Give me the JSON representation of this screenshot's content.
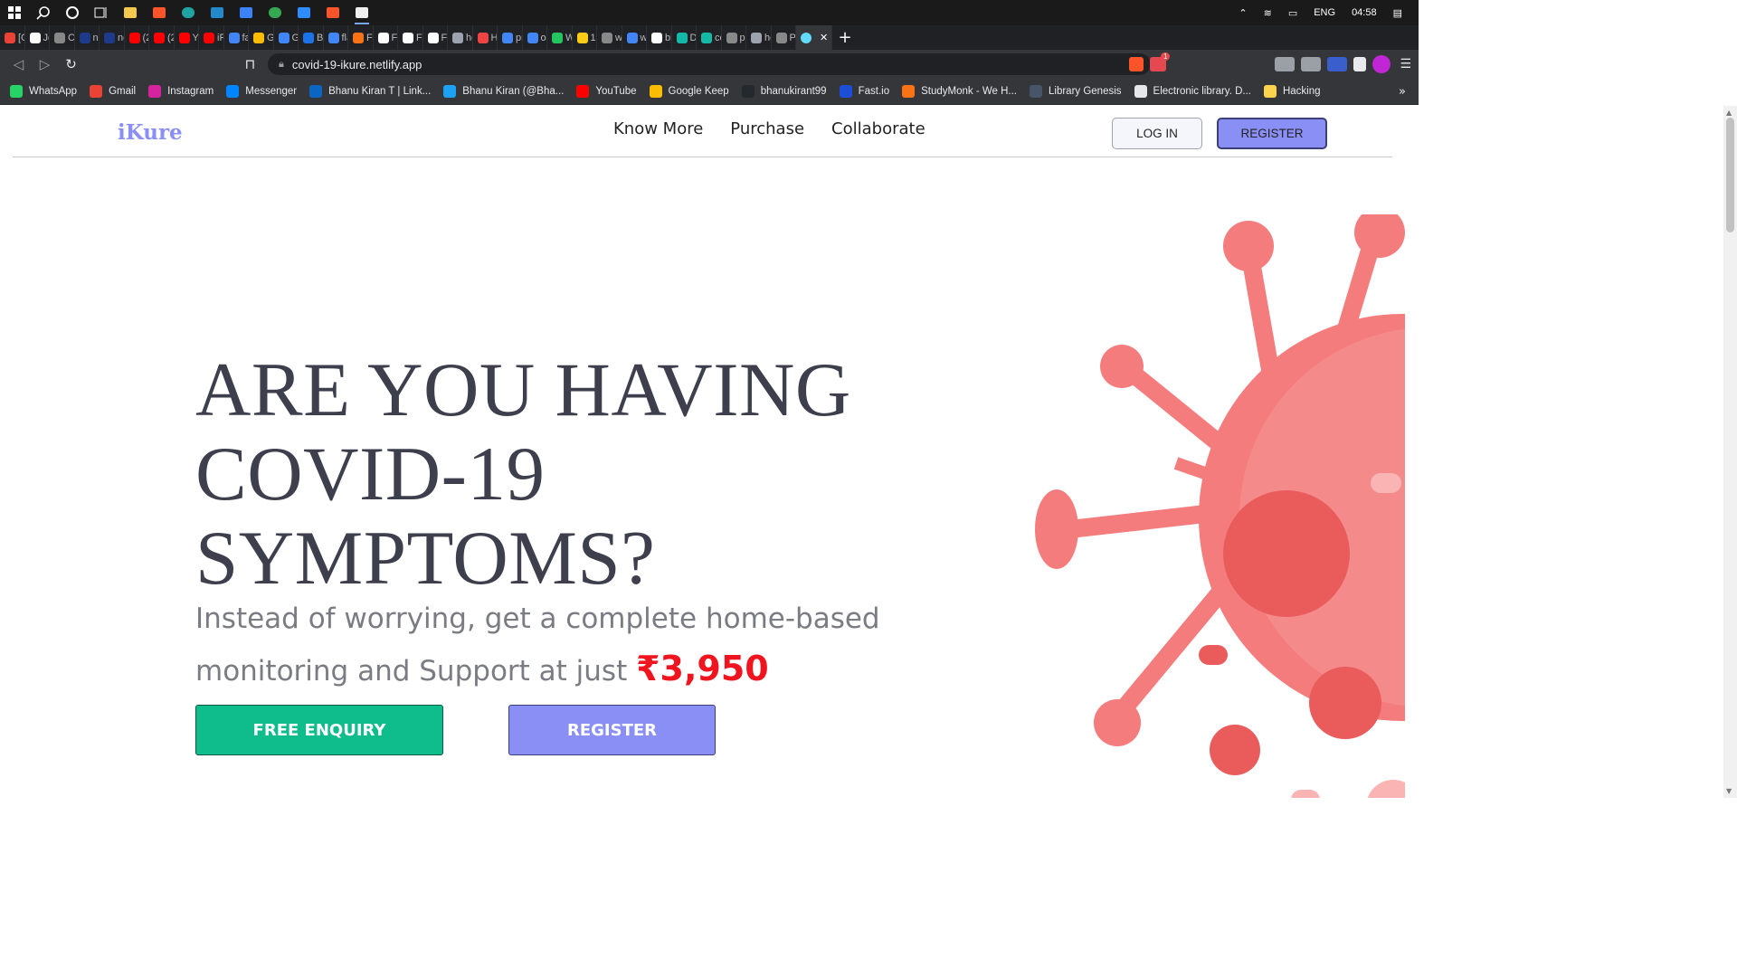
{
  "taskbar": {
    "lang": "ENG",
    "time": "04:58"
  },
  "tabs": [
    {
      "label": "[G",
      "color": "#ea4335"
    },
    {
      "label": "Jo",
      "color": "#ffffff"
    },
    {
      "label": "CS",
      "color": "#888888"
    },
    {
      "label": "ne",
      "color": "#1e3a8a"
    },
    {
      "label": "ne",
      "color": "#1e3a8a"
    },
    {
      "label": "(2",
      "color": "#ff0000"
    },
    {
      "label": "(2",
      "color": "#ff0000"
    },
    {
      "label": "Yo",
      "color": "#ff0000"
    },
    {
      "label": "iPl",
      "color": "#ff0000"
    },
    {
      "label": "fai",
      "color": "#4285f4"
    },
    {
      "label": "Gc",
      "color": "#fbbc04"
    },
    {
      "label": "Gc",
      "color": "#4285f4"
    },
    {
      "label": "BN",
      "color": "#1a73e8"
    },
    {
      "label": "fla",
      "color": "#4285f4"
    },
    {
      "label": "Fla",
      "color": "#f97316"
    },
    {
      "label": "Fla",
      "color": "#ffffff"
    },
    {
      "label": "Fla",
      "color": "#ffffff"
    },
    {
      "label": "Fla",
      "color": "#ffffff"
    },
    {
      "label": "ho",
      "color": "#9ca3af"
    },
    {
      "label": "Hi",
      "color": "#ef4444"
    },
    {
      "label": "pri",
      "color": "#4285f4"
    },
    {
      "label": "on",
      "color": "#4285f4"
    },
    {
      "label": "W",
      "color": "#22c55e"
    },
    {
      "label": "10",
      "color": "#facc15"
    },
    {
      "label": "wv",
      "color": "#888888"
    },
    {
      "label": "wh",
      "color": "#4285f4"
    },
    {
      "label": "bh",
      "color": "#ffffff"
    },
    {
      "label": "Dc",
      "color": "#14b8a6"
    },
    {
      "label": "co",
      "color": "#14b8a6"
    },
    {
      "label": "pr",
      "color": "#888888"
    },
    {
      "label": "ho",
      "color": "#9ca3af"
    },
    {
      "label": "Pc",
      "color": "#888888"
    }
  ],
  "address": {
    "url": "covid-19-ikure.netlify.app",
    "badge": "1"
  },
  "bookmarks": [
    {
      "label": "WhatsApp",
      "icon": "whatsapp-icon",
      "color": "#25d366"
    },
    {
      "label": "Gmail",
      "icon": "gmail-icon",
      "color": "#ea4335"
    },
    {
      "label": "Instagram",
      "icon": "instagram-icon",
      "color": "#d6249f"
    },
    {
      "label": "Messenger",
      "icon": "messenger-icon",
      "color": "#0084ff"
    },
    {
      "label": "Bhanu Kiran T | Link...",
      "icon": "linkedin-icon",
      "color": "#0a66c2"
    },
    {
      "label": "Bhanu Kiran (@Bha...",
      "icon": "twitter-icon",
      "color": "#1da1f2"
    },
    {
      "label": "YouTube",
      "icon": "youtube-icon",
      "color": "#ff0000"
    },
    {
      "label": "Google Keep",
      "icon": "keep-icon",
      "color": "#fbbc04"
    },
    {
      "label": "bhanukirant99",
      "icon": "github-icon",
      "color": "#24292e"
    },
    {
      "label": "Fast.io",
      "icon": "fastio-icon",
      "color": "#1d4ed8"
    },
    {
      "label": "StudyMonk - We H...",
      "icon": "studymonk-icon",
      "color": "#f97316"
    },
    {
      "label": "Library Genesis",
      "icon": "libgen-icon",
      "color": "#475569"
    },
    {
      "label": "Electronic library. D...",
      "icon": "zlib-icon",
      "color": "#e5e7eb"
    },
    {
      "label": "Hacking",
      "icon": "folder-icon",
      "color": "#fcd34d"
    }
  ],
  "site": {
    "logo": "iKure",
    "nav": [
      "Know More",
      "Purchase",
      "Collaborate"
    ],
    "login": "LOG IN",
    "register_top": "REGISTER",
    "headline": "ARE YOU HAVING COVID-19 SYMPTOMS?",
    "sub_text": "Instead of worrying, get a complete home-based monitoring and Support at just",
    "price": "₹3,950",
    "free_enquiry": "FREE ENQUIRY",
    "register_main": "REGISTER",
    "colors": {
      "brand": "#8a8ff5",
      "enquiry": "#0fbc8b",
      "price": "#f0141e",
      "virus": "#f47c7c",
      "virus_dark": "#ea5b5b"
    }
  }
}
